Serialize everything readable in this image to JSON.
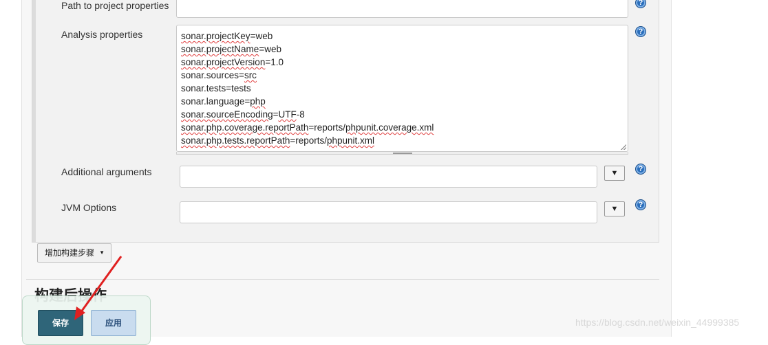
{
  "form": {
    "path_label": "Path to project properties",
    "path_value": "",
    "analysis_label": "Analysis properties",
    "analysis_lines": [
      [
        {
          "t": "sonar.projectKey",
          "u": true
        },
        {
          "t": "=web",
          "u": false
        }
      ],
      [
        {
          "t": "sonar.projectName",
          "u": true
        },
        {
          "t": "=web",
          "u": false
        }
      ],
      [
        {
          "t": "sonar.projectVersion",
          "u": true
        },
        {
          "t": "=1.0",
          "u": false
        }
      ],
      [
        {
          "t": "sonar.sources=",
          "u": false
        },
        {
          "t": "src",
          "u": true
        }
      ],
      [
        {
          "t": "sonar.tests=tests",
          "u": false
        }
      ],
      [
        {
          "t": "sonar.language=",
          "u": false
        },
        {
          "t": "php",
          "u": true
        }
      ],
      [
        {
          "t": "sonar.sourceEncoding",
          "u": true
        },
        {
          "t": "=",
          "u": false
        },
        {
          "t": "UTF",
          "u": true
        },
        {
          "t": "-8",
          "u": false
        }
      ],
      [
        {
          "t": "sonar.php.coverage.reportPath",
          "u": true
        },
        {
          "t": "=reports/",
          "u": false
        },
        {
          "t": "phpunit.coverage.xml",
          "u": true
        }
      ],
      [
        {
          "t": "sonar.php.tests.reportPath",
          "u": true
        },
        {
          "t": "=reports/",
          "u": false
        },
        {
          "t": "phpunit.xml",
          "u": true
        }
      ]
    ],
    "additional_label": "Additional arguments",
    "additional_value": "",
    "jvm_label": "JVM Options",
    "jvm_value": "",
    "dropdown_glyph": "▼",
    "help_glyph": "?"
  },
  "actions": {
    "add_step_label": "增加构建步骤",
    "add_step_caret": "▼",
    "post_build_title": "构建后操作",
    "save_label": "保存",
    "apply_label": "应用"
  },
  "watermark": "https://blog.csdn.net/weixin_44999385",
  "colors": {
    "save_bg": "#2f6579",
    "apply_bg": "#c9dcef",
    "help_icon": "#2a6ebb",
    "annotation_arrow": "#e02020"
  }
}
